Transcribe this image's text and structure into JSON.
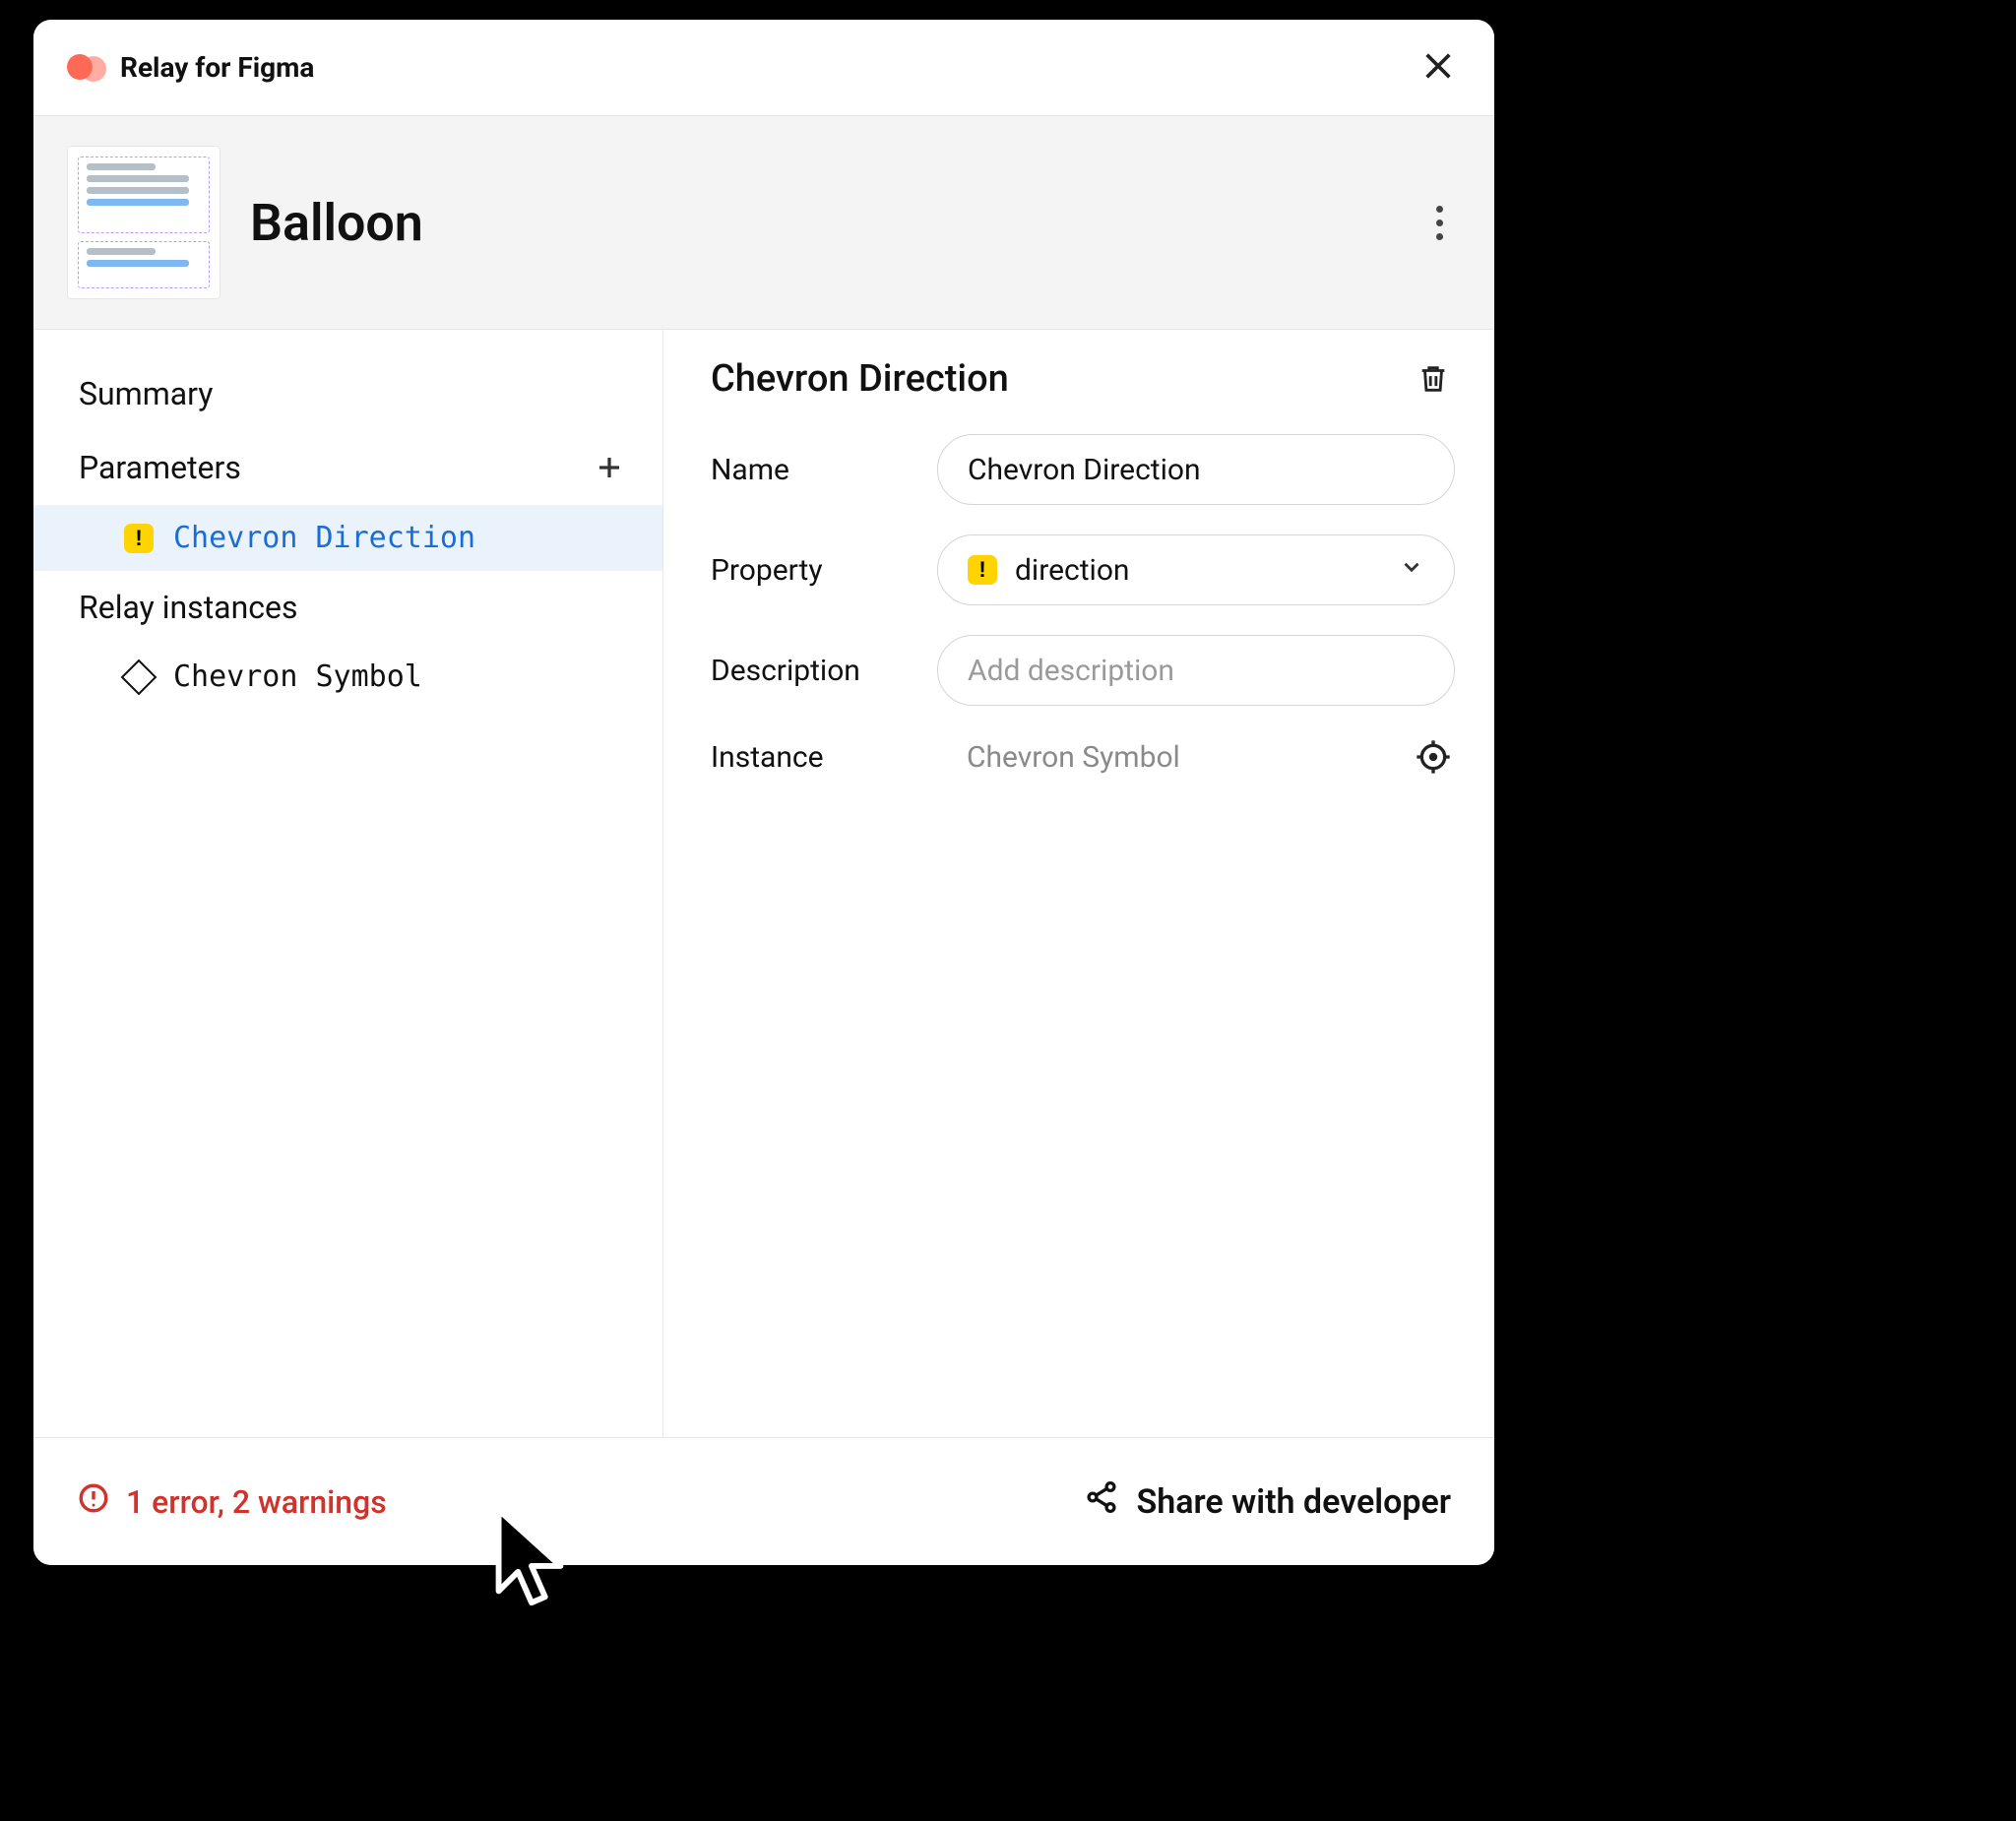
{
  "titlebar": {
    "app_name": "Relay for Figma"
  },
  "component": {
    "name": "Balloon"
  },
  "sidebar": {
    "summary_label": "Summary",
    "parameters_label": "Parameters",
    "parameters": [
      {
        "label": "Chevron Direction",
        "has_warning": true,
        "selected": true
      }
    ],
    "instances_label": "Relay instances",
    "instances": [
      {
        "label": "Chevron Symbol"
      }
    ]
  },
  "detail": {
    "title": "Chevron Direction",
    "fields": {
      "name_label": "Name",
      "name_value": "Chevron Direction",
      "property_label": "Property",
      "property_value": "direction",
      "property_has_warning": true,
      "description_label": "Description",
      "description_placeholder": "Add description",
      "instance_label": "Instance",
      "instance_value": "Chevron Symbol"
    }
  },
  "footer": {
    "error_summary": "1 error, 2 warnings",
    "share_label": "Share with developer"
  }
}
